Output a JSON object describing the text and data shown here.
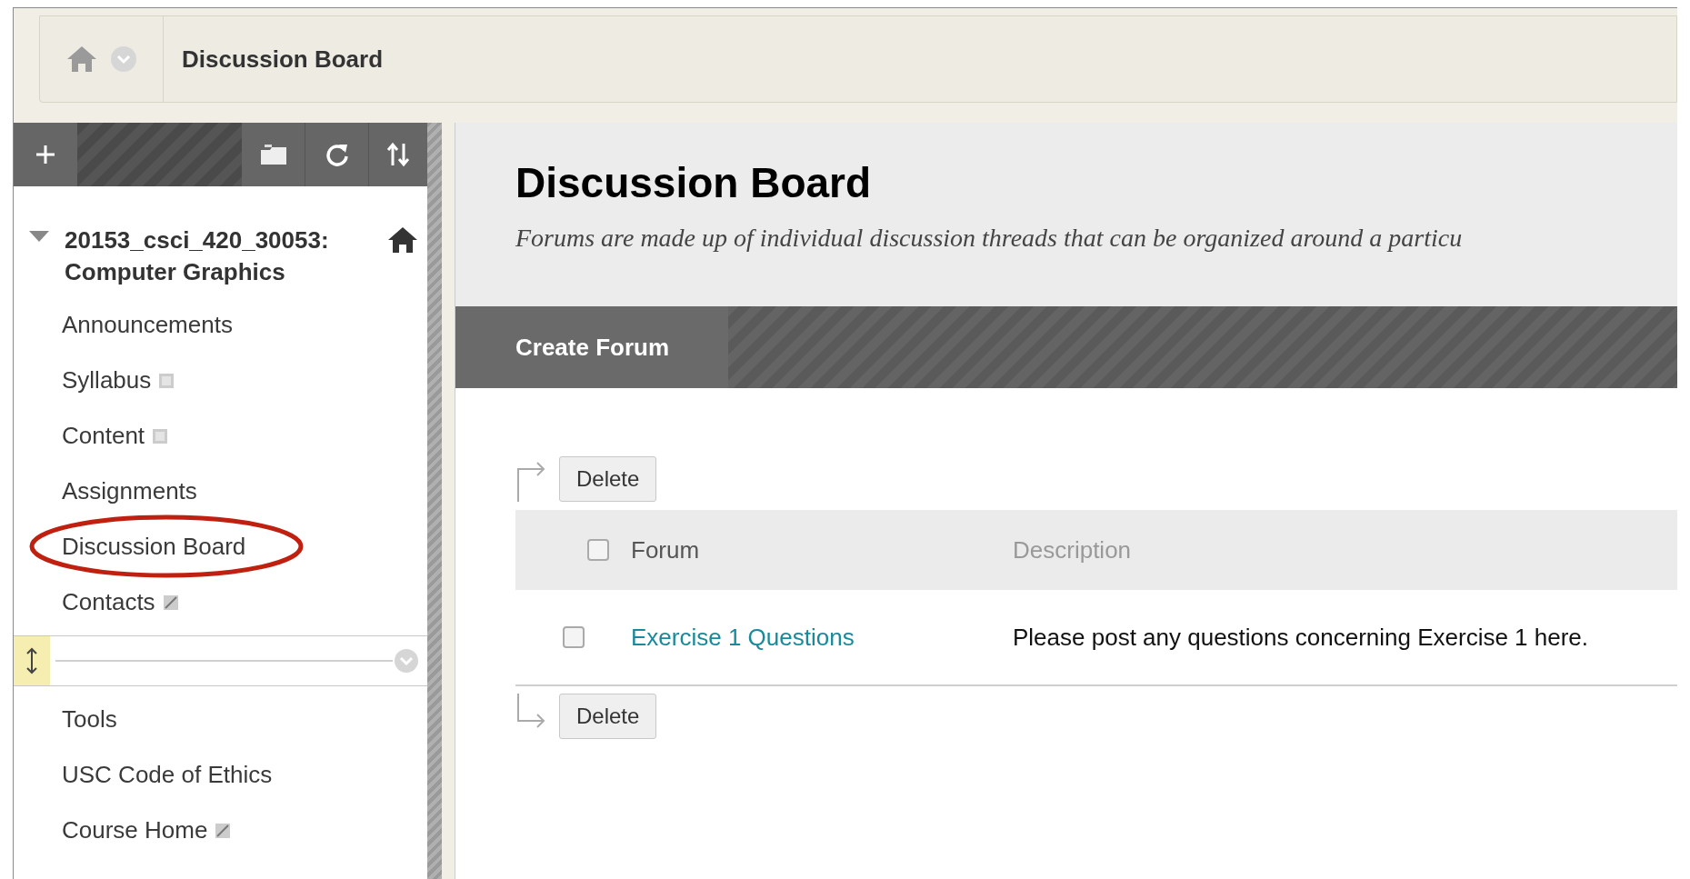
{
  "breadcrumb": {
    "current": "Discussion Board"
  },
  "course": {
    "title": "20153_csci_420_30053: Computer Graphics",
    "expanded": true
  },
  "menu_items": [
    {
      "label": "Announcements",
      "kind": "plain"
    },
    {
      "label": "Syllabus",
      "kind": "module"
    },
    {
      "label": "Content",
      "kind": "module"
    },
    {
      "label": "Assignments",
      "kind": "plain"
    },
    {
      "label": "Discussion Board",
      "kind": "plain",
      "circled": true
    },
    {
      "label": "Contacts",
      "kind": "link"
    }
  ],
  "menu_items_below": [
    {
      "label": "Tools",
      "kind": "plain"
    },
    {
      "label": "USC Code of Ethics",
      "kind": "plain"
    },
    {
      "label": "Course Home",
      "kind": "link"
    }
  ],
  "page": {
    "title": "Discussion Board",
    "description": "Forums are made up of individual discussion threads that can be organized around a particu"
  },
  "action_bar": {
    "button": "Create Forum"
  },
  "table": {
    "top_button": "Delete",
    "bottom_button": "Delete",
    "select_all_checked": false,
    "columns": [
      "Forum",
      "Description"
    ],
    "rows": [
      {
        "forum": "Exercise 1 Questions",
        "description": "Please post any questions concerning Exercise 1 here.",
        "checked": false
      }
    ]
  }
}
